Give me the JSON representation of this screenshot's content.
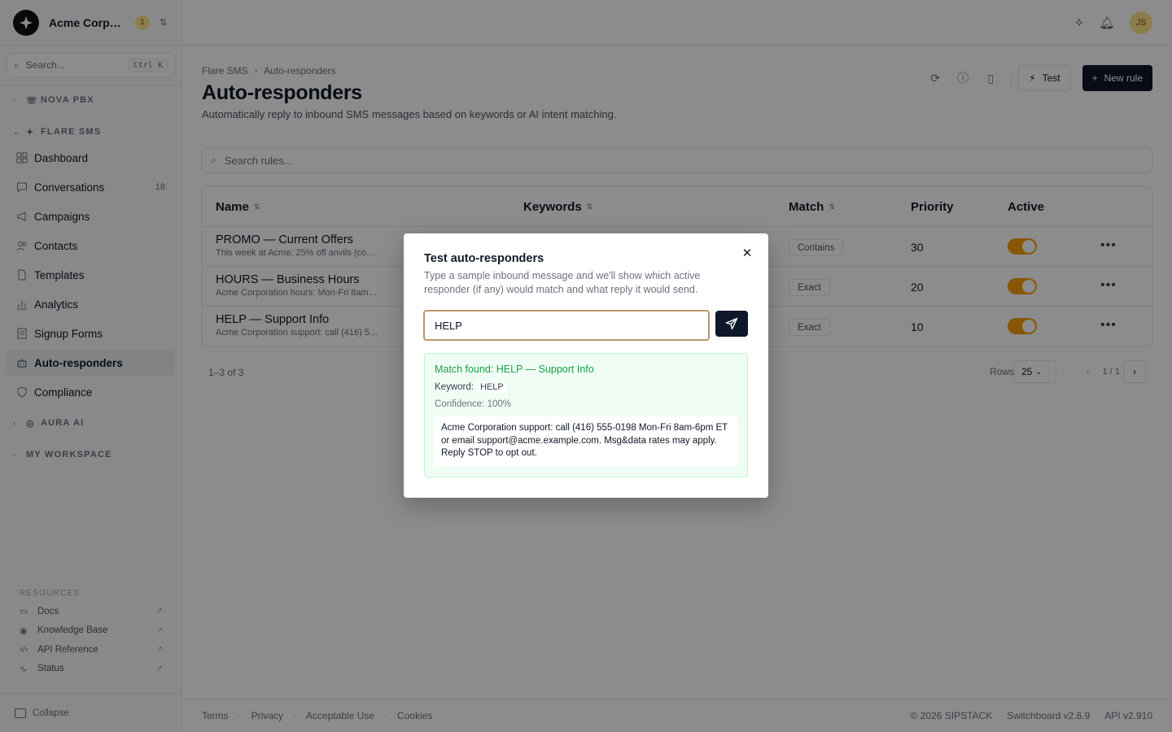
{
  "org": {
    "name": "Acme Corporation",
    "badge": "1"
  },
  "sidebar": {
    "search_placeholder": "Search...",
    "search_shortcut": "Ctrl K",
    "sections": {
      "nova": "NOVA PBX",
      "flare": "FLARE SMS",
      "aura": "AURA AI",
      "workspace": "MY WORKSPACE"
    },
    "items": [
      {
        "label": "Dashboard",
        "icon": "grid-icon",
        "count": ""
      },
      {
        "label": "Conversations",
        "icon": "chat-icon",
        "count": "18"
      },
      {
        "label": "Campaigns",
        "icon": "megaphone-icon",
        "count": ""
      },
      {
        "label": "Contacts",
        "icon": "users-icon",
        "count": ""
      },
      {
        "label": "Templates",
        "icon": "file-icon",
        "count": ""
      },
      {
        "label": "Analytics",
        "icon": "chart-icon",
        "count": ""
      },
      {
        "label": "Signup Forms",
        "icon": "form-icon",
        "count": ""
      },
      {
        "label": "Auto-responders",
        "icon": "bot-icon",
        "count": ""
      },
      {
        "label": "Compliance",
        "icon": "shield-icon",
        "count": ""
      }
    ],
    "resources": {
      "heading": "RESOURCES",
      "items": [
        {
          "label": "Docs",
          "icon": "book-icon"
        },
        {
          "label": "Knowledge Base",
          "icon": "help-icon"
        },
        {
          "label": "API Reference",
          "icon": "code-icon"
        },
        {
          "label": "Status",
          "icon": "activity-icon"
        }
      ]
    },
    "collapse_label": "Collapse"
  },
  "topbar": {
    "avatar_initials": "JS"
  },
  "page": {
    "breadcrumb": [
      "Flare SMS",
      "Auto-responders"
    ],
    "title": "Auto-responders",
    "subtitle": "Automatically reply to inbound SMS messages based on keywords or AI intent matching.",
    "test_label": "Test",
    "new_rule_label": "New rule",
    "rules_search_placeholder": "Search rules..."
  },
  "table": {
    "columns": {
      "name": "Name",
      "keywords": "Keywords",
      "match": "Match",
      "priority": "Priority",
      "active": "Active"
    },
    "rows": [
      {
        "name": "PROMO — Current Offers",
        "preview": "This week at Acme: 25% off anvils (co…",
        "match": "Contains",
        "priority": "30",
        "active": true
      },
      {
        "name": "HOURS — Business Hours",
        "preview": "Acme Corporation hours: Mon-Fri 8am…",
        "match": "Exact",
        "priority": "20",
        "active": true
      },
      {
        "name": "HELP — Support Info",
        "preview": "Acme Corporation support: call (416) 5…",
        "match": "Exact",
        "priority": "10",
        "active": true
      }
    ],
    "count_text": "1–3 of 3",
    "rows_label": "Rows",
    "rows_value": "25",
    "page_text": "1 / 1"
  },
  "footer": {
    "links": [
      "Terms",
      "Privacy",
      "Acceptable Use",
      "Cookies"
    ],
    "copyright": "© 2026 SIPSTACK",
    "version": "Switchboard v2.6.9",
    "api": "API v2.910"
  },
  "modal": {
    "title": "Test auto-responders",
    "description": "Type a sample inbound message and we'll show which active responder (if any) would match and what reply it would send.",
    "input_value": "HELP",
    "result": {
      "title": "Match found: HELP — Support Info",
      "keyword_label": "Keyword:",
      "keyword_value": "HELP",
      "confidence": "Confidence: 100%",
      "reply": "Acme Corporation support: call (416) 555-0198 Mon-Fri 8am-6pm ET or email support@acme.example.com. Msg&data rates may apply. Reply STOP to opt out."
    }
  },
  "colors": {
    "accent": "#f59e0b",
    "primary": "#0f172a",
    "success": "#16a34a"
  }
}
